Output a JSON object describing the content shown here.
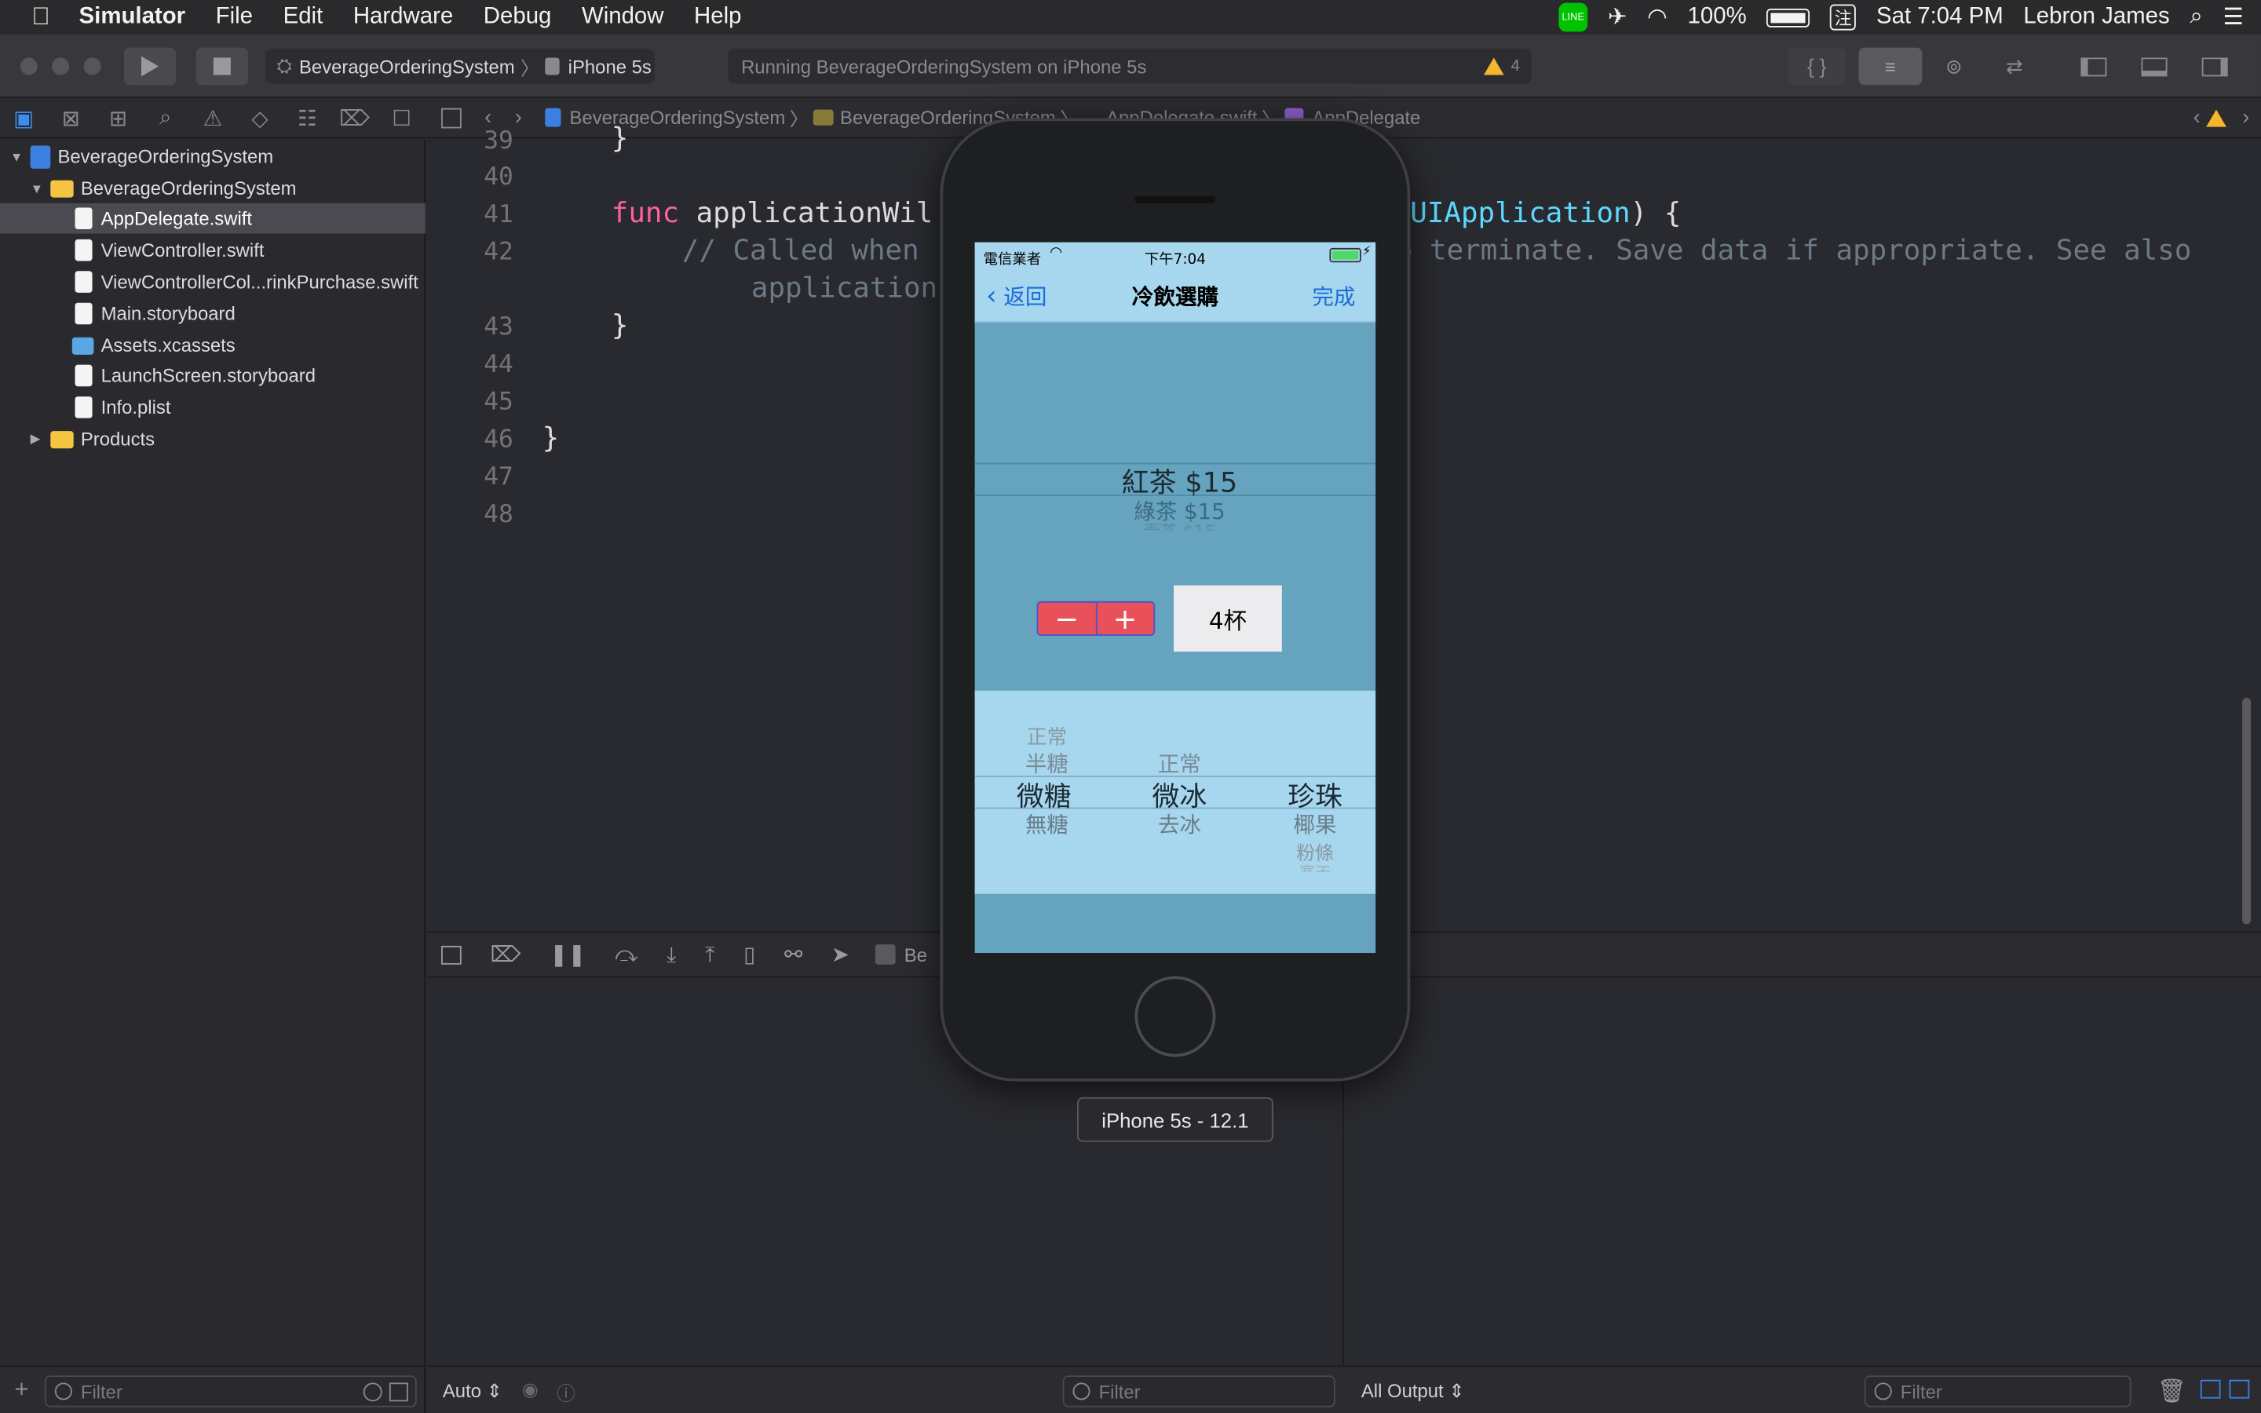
{
  "menubar": {
    "app": "Simulator",
    "items": [
      "File",
      "Edit",
      "Hardware",
      "Debug",
      "Window",
      "Help"
    ],
    "battery": "100%",
    "input_method": "注",
    "clock": "Sat 7:04 PM",
    "user": "Lebron James"
  },
  "toolbar": {
    "scheme": "BeverageOrderingSystem",
    "device": "iPhone 5s",
    "status": "Running BeverageOrderingSystem on iPhone 5s",
    "warning_count": "4"
  },
  "navigator": {
    "project": "BeverageOrderingSystem",
    "group": "BeverageOrderingSystem",
    "files": [
      "AppDelegate.swift",
      "ViewController.swift",
      "ViewControllerCol...rinkPurchase.swift",
      "Main.storyboard",
      "Assets.xcassets",
      "LaunchScreen.storyboard",
      "Info.plist"
    ],
    "products": "Products",
    "filter_placeholder": "Filter"
  },
  "jumpbar": [
    "BeverageOrderingSystem",
    "BeverageOrderingSystem",
    "AppDelegate.swift",
    "AppDelegate"
  ],
  "editor": {
    "line_numbers": [
      "39",
      "40",
      "41",
      "42",
      "",
      "43",
      "44",
      "45",
      "46",
      "47",
      "48"
    ],
    "line_41_kw": "func",
    "line_41_name": "applicationWil",
    "line_41_type": "UIApplication",
    "line_41_end": ") {",
    "line_42_a": "// Called when",
    "line_42_b": "o terminate. Save data if appropriate. See also",
    "line_42_cont": "application",
    "brace_43": "}",
    "brace_46": "}"
  },
  "debug": {
    "auto": "Auto",
    "filter": "Filter",
    "all_output": "All Output",
    "output_filter": "Filter",
    "partial_label": "Be"
  },
  "simulator": {
    "label": "iPhone 5s - 12.1",
    "carrier": "電信業者",
    "time": "下午7:04",
    "nav_back": "返回",
    "nav_title": "冷飲選購",
    "nav_done": "完成",
    "drink_picker": [
      "紅茶 $15",
      "綠茶 $15",
      "青茶 $15"
    ],
    "quantity": "4杯",
    "stepper_minus": "−",
    "stepper_plus": "+",
    "sugar_picker": [
      "正常",
      "半糖",
      "微糖",
      "無糖"
    ],
    "ice_picker": [
      "正常",
      "微冰",
      "去冰"
    ],
    "topping_picker": [
      "珍珠",
      "椰果",
      "粉條",
      "寒天"
    ]
  }
}
